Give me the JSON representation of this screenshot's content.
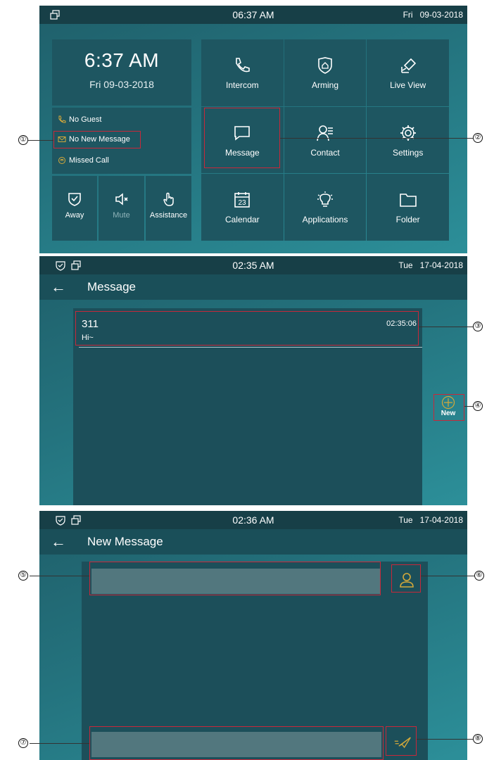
{
  "colors": {
    "accent": "#d4a93a",
    "highlight": "#c8283a",
    "panel": "#1e5661",
    "statusbar": "#173f47"
  },
  "screen_home": {
    "status": {
      "time": "06:37 AM",
      "day": "Fri",
      "date": "09-03-2018"
    },
    "clock": {
      "time": "6:37 AM",
      "date": "Fri 09-03-2018"
    },
    "notices": [
      "No Guest",
      "No New Message",
      "Missed Call"
    ],
    "quick": [
      {
        "label": "Away",
        "icon": "shield-icon"
      },
      {
        "label": "Mute",
        "icon": "speaker-mute-icon"
      },
      {
        "label": "Assistance",
        "icon": "hand-pointer-icon"
      }
    ],
    "tiles": [
      {
        "label": "Intercom",
        "icon": "phone-icon"
      },
      {
        "label": "Arming",
        "icon": "shield-home-icon"
      },
      {
        "label": "Live View",
        "icon": "camera-icon"
      },
      {
        "label": "Message",
        "icon": "chat-icon"
      },
      {
        "label": "Contact",
        "icon": "contact-icon"
      },
      {
        "label": "Settings",
        "icon": "gear-icon"
      },
      {
        "label": "Calendar",
        "icon": "calendar-icon",
        "day": "23"
      },
      {
        "label": "Applications",
        "icon": "bulb-icon"
      },
      {
        "label": "Folder",
        "icon": "folder-icon"
      }
    ]
  },
  "screen_message": {
    "status": {
      "time": "02:35 AM",
      "day": "Tue",
      "date": "17-04-2018"
    },
    "title": "Message",
    "back": "←",
    "items": [
      {
        "sender": "311",
        "time": "02:35:06",
        "text": "Hi~"
      }
    ],
    "new_label": "New"
  },
  "screen_new": {
    "status": {
      "time": "02:36 AM",
      "day": "Tue",
      "date": "17-04-2018"
    },
    "title": "New Message",
    "back": "←"
  },
  "callouts": [
    "①",
    "②",
    "③",
    "④",
    "⑤",
    "⑥",
    "⑦",
    "⑧"
  ]
}
